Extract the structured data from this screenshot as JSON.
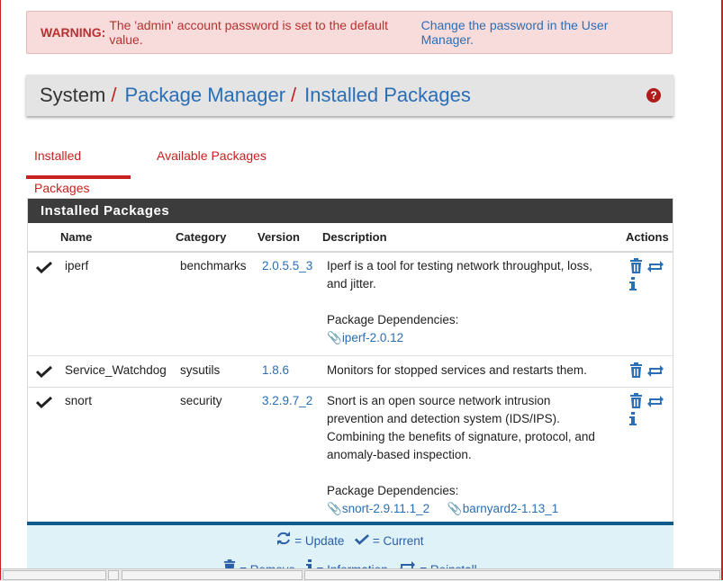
{
  "alert": {
    "label": "WARNING:",
    "message": "The 'admin' account password is set to the default value.",
    "link": "Change the password in the User Manager."
  },
  "breadcrumb": {
    "root": "System",
    "sep1": "/",
    "item1": "Package Manager",
    "sep2": "/",
    "item2": "Installed Packages"
  },
  "tabs": [
    {
      "label": "Installed Packages",
      "active": true
    },
    {
      "label": "Available Packages",
      "active": false
    }
  ],
  "panel": {
    "title": "Installed Packages",
    "columns": {
      "name": "Name",
      "category": "Category",
      "version": "Version",
      "description": "Description",
      "actions": "Actions"
    }
  },
  "packages": [
    {
      "name": "iperf",
      "category": "benchmarks",
      "version": "2.0.5.5_3",
      "desc1": "Iperf is a tool for testing network throughput, loss,",
      "desc2": "and jitter.",
      "deps_label": "Package Dependencies:",
      "deps": [
        "iperf-2.0.12"
      ]
    },
    {
      "name": "Service_Watchdog",
      "category": "sysutils",
      "version": "1.8.6",
      "desc1": "Monitors for stopped services and restarts them."
    },
    {
      "name": "snort",
      "category": "security",
      "version": "3.2.9.7_2",
      "desc1": "Snort is an open source network intrusion",
      "desc2": "prevention and detection system (IDS/IPS).",
      "desc3": "Combining the benefits of signature, protocol, and",
      "desc4": "anomaly-based inspection.",
      "deps_label": "Package Dependencies:",
      "deps": [
        "snort-2.9.11.1_2",
        "barnyard2-1.13_1"
      ]
    }
  ],
  "legend": {
    "update": "= Update",
    "current": "= Current",
    "remove": "= Remove",
    "information": "= Information",
    "reinstall": "= Reinstall"
  },
  "colors": {
    "accent": "#c8211f",
    "link": "#2a6eb5",
    "panel_head": "#3c3c3c",
    "legend_bg": "#dff2f8",
    "legend_border": "#0e5b8c"
  }
}
